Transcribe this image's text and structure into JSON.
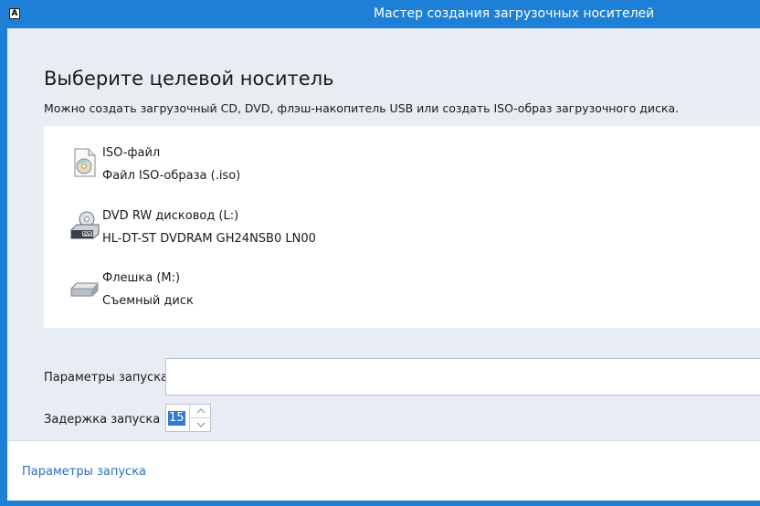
{
  "window": {
    "title": "Мастер создания загрузочных носителей",
    "app_icon_glyph": "A"
  },
  "main": {
    "heading": "Выберите целевой носитель",
    "description": "Можно создать загрузочный CD, DVD, флэш-накопитель USB или создать ISO-образ загрузочного диска."
  },
  "devices": [
    {
      "name": "ISO-файл",
      "sub": "Файл ISO-образа (.iso)",
      "icon": "iso-file-icon"
    },
    {
      "name": "DVD RW дисковод (L:)",
      "sub": "HL-DT-ST DVDRAM GH24NSB0 LN00",
      "icon": "dvd-drive-icon"
    },
    {
      "name": "Флешка (M:)",
      "sub": "Съемный диск",
      "icon": "removable-disk-icon"
    }
  ],
  "launch_params": {
    "label": "Параметры запуска",
    "value": ""
  },
  "launch_delay": {
    "label": "Задержка запуска",
    "value": "15"
  },
  "footer": {
    "link": "Параметры запуска"
  },
  "colors": {
    "titlebar": "#1e7fd6",
    "client": "#e8edf3",
    "link": "#2c6fbc",
    "selection": "#2f7ad2"
  }
}
